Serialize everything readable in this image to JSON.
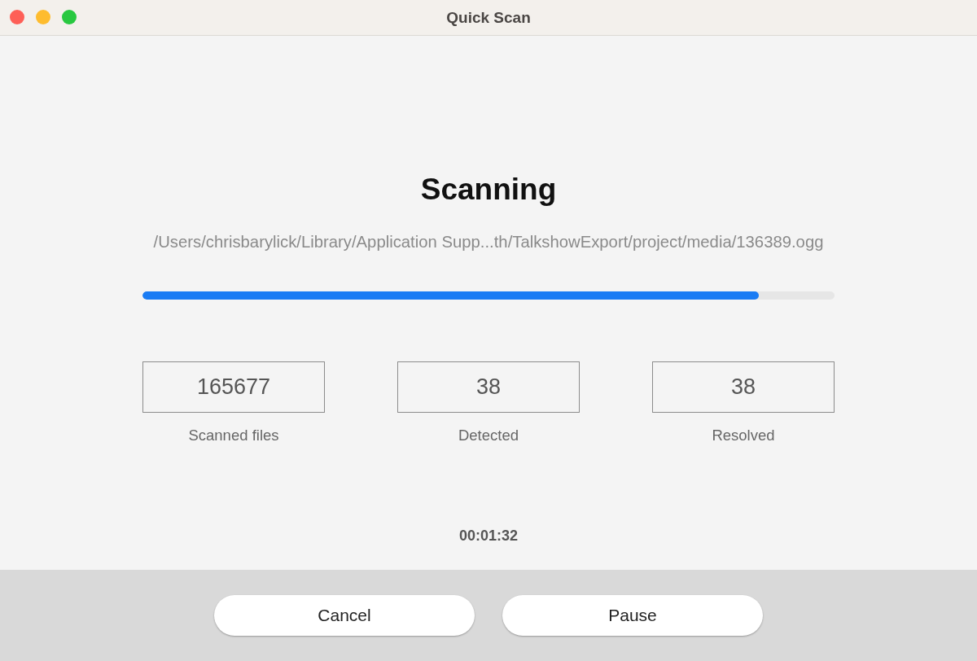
{
  "window": {
    "title": "Quick Scan"
  },
  "heading": "Scanning",
  "current_path": "/Users/chrisbarylick/Library/Application Supp...th/TalkshowExport/project/media/136389.ogg",
  "progress": {
    "level": 0.89
  },
  "stats": [
    {
      "value": "165677",
      "label": "Scanned files"
    },
    {
      "value": "38",
      "label": "Detected"
    },
    {
      "value": "38",
      "label": "Resolved"
    }
  ],
  "elapsed": "00:01:32",
  "buttons": [
    "Cancel",
    "Pause"
  ]
}
